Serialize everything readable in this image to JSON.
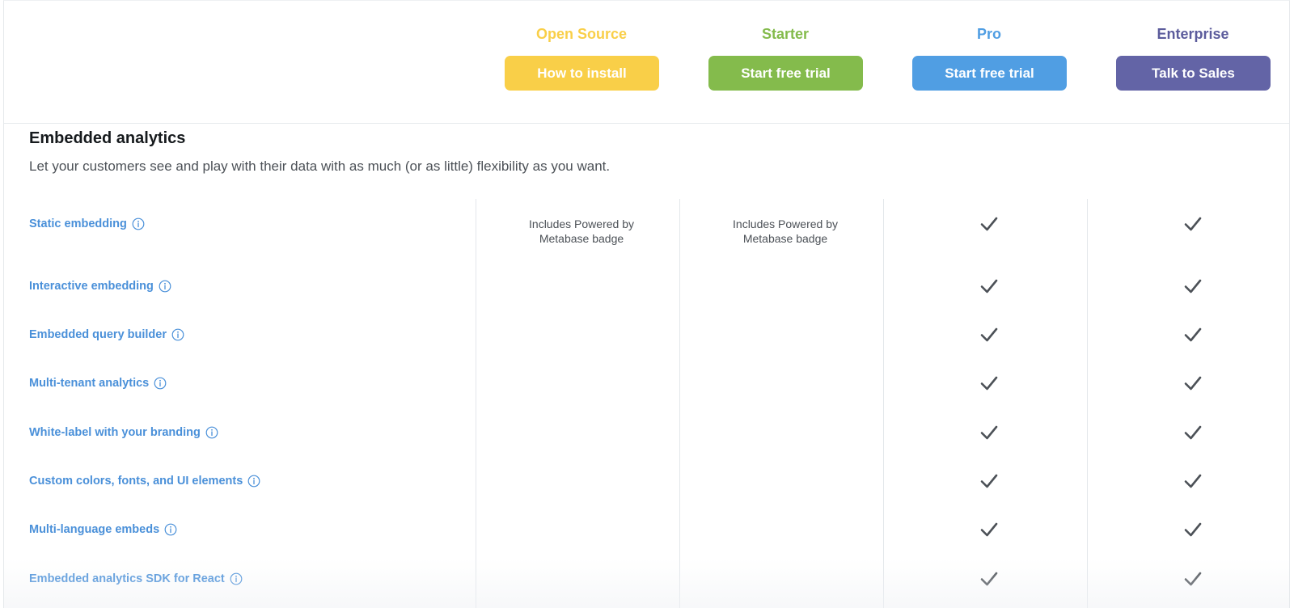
{
  "plans": [
    {
      "name": "Open Source",
      "button": "How to install",
      "name_color": "#f9cf48",
      "button_color": "#f9cf48"
    },
    {
      "name": "Starter",
      "button": "Start free trial",
      "name_color": "#84bb4c",
      "button_color": "#84bb4c"
    },
    {
      "name": "Pro",
      "button": "Start free trial",
      "name_color": "#509ee3",
      "button_color": "#509ee3"
    },
    {
      "name": "Enterprise",
      "button": "Talk to Sales",
      "name_color": "#5c5c9c",
      "button_color": "#6364a6"
    }
  ],
  "section": {
    "title": "Embedded analytics",
    "description": "Let your customers see and play with their data with as much (or as little) flexibility as you want."
  },
  "features": [
    {
      "label": "Static embedding",
      "open_source": "Includes Powered by Metabase badge",
      "starter": "Includes Powered by Metabase badge",
      "pro": true,
      "enterprise": true
    },
    {
      "label": "Interactive embedding",
      "open_source": "",
      "starter": "",
      "pro": true,
      "enterprise": true
    },
    {
      "label": "Embedded query builder",
      "open_source": "",
      "starter": "",
      "pro": true,
      "enterprise": true
    },
    {
      "label": "Multi-tenant analytics",
      "open_source": "",
      "starter": "",
      "pro": true,
      "enterprise": true
    },
    {
      "label": "White-label with your branding",
      "open_source": "",
      "starter": "",
      "pro": true,
      "enterprise": true
    },
    {
      "label": "Custom colors, fonts, and UI elements",
      "open_source": "",
      "starter": "",
      "pro": true,
      "enterprise": true
    },
    {
      "label": "Multi-language embeds",
      "open_source": "",
      "starter": "",
      "pro": true,
      "enterprise": true
    },
    {
      "label": "Embedded analytics SDK for React",
      "open_source": "",
      "starter": "",
      "pro": true,
      "enterprise": true
    }
  ],
  "icons": {
    "info": "info-circle-icon",
    "check": "check-icon"
  },
  "colors": {
    "feature_link": "#4a90d9",
    "check": "#4c5157"
  }
}
